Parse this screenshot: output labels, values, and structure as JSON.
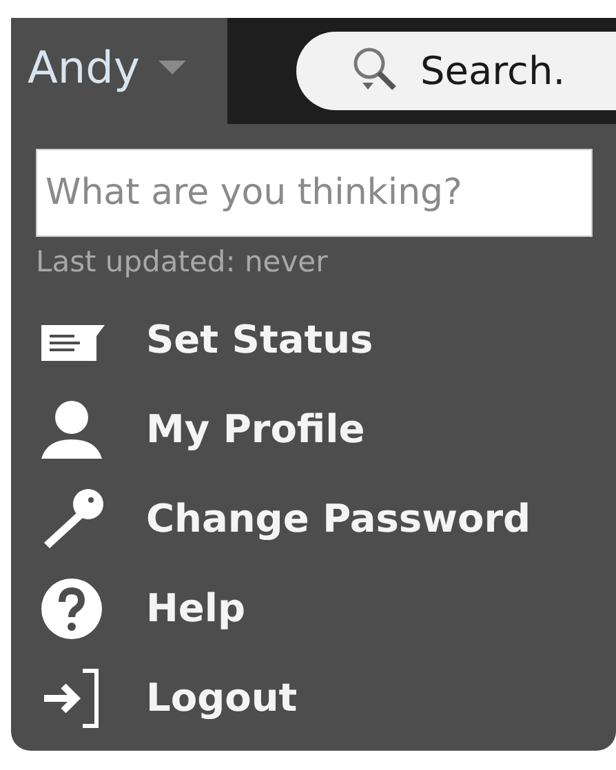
{
  "user_menu": {
    "label": "Andy"
  },
  "search": {
    "placeholder": "Search."
  },
  "status_field": {
    "placeholder": "What are you thinking?"
  },
  "last_updated": "Last updated: never",
  "menu_items": [
    {
      "kind": "status",
      "label": "Set Status"
    },
    {
      "kind": "profile",
      "label": "My Profile"
    },
    {
      "kind": "password",
      "label": "Change Password"
    },
    {
      "kind": "help",
      "label": "Help"
    },
    {
      "kind": "logout",
      "label": "Logout"
    }
  ]
}
